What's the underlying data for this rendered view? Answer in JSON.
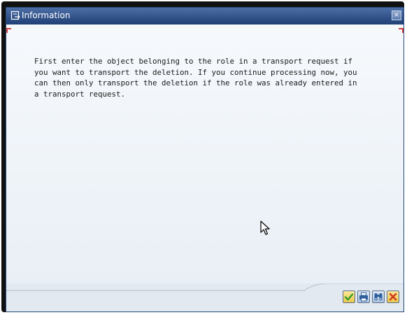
{
  "window": {
    "title": "Information",
    "close_glyph": "×"
  },
  "message": {
    "lines": [
      "First enter the object belonging to the role in a transport request if",
      "you want to transport the deletion. If you continue processing now, you",
      "can then only transport the deletion if the role was already entered in",
      "a transport request."
    ]
  },
  "footer": {
    "buttons": [
      {
        "name": "continue-button",
        "icon": "checkmark-icon",
        "color": "#2e9b2e"
      },
      {
        "name": "print-button",
        "icon": "printer-icon",
        "color": "#2f5f9e"
      },
      {
        "name": "find-button",
        "icon": "binoculars-icon",
        "color": "#2f5f9e"
      },
      {
        "name": "cancel-button",
        "icon": "x-icon",
        "color": "#d23a1a"
      }
    ]
  },
  "colors": {
    "title_bar": "#1f3f75",
    "content_bg": "#eef3f8",
    "accent_red": "#d34040"
  }
}
